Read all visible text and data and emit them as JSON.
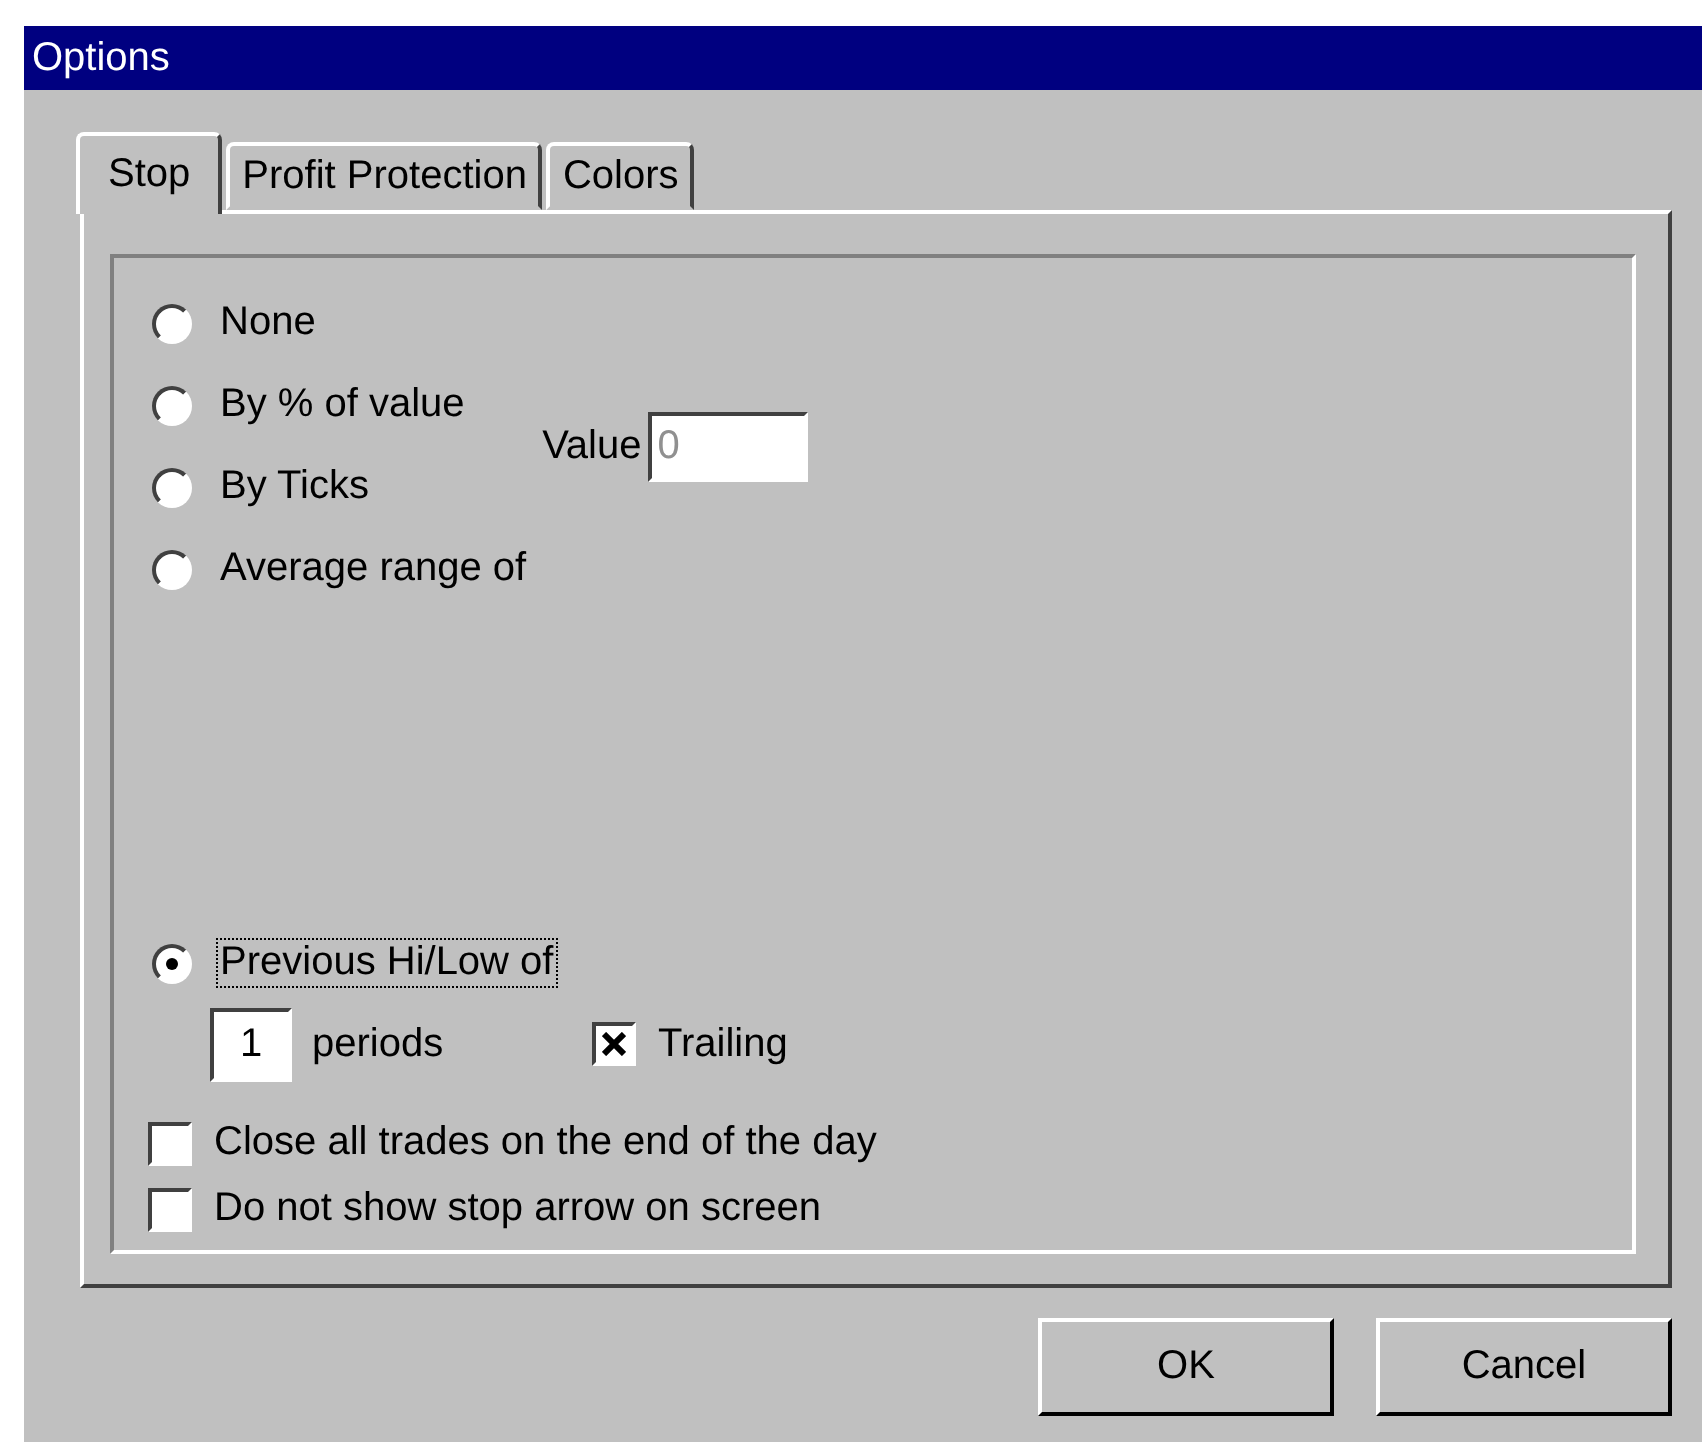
{
  "window": {
    "title": "Options"
  },
  "tabs": [
    {
      "label": "Stop",
      "selected": true
    },
    {
      "label": "Profit Protection",
      "selected": false
    },
    {
      "label": "Colors",
      "selected": false
    }
  ],
  "stop_options": [
    {
      "label": "None",
      "selected": false,
      "focused": false
    },
    {
      "label": "By % of value",
      "selected": false,
      "focused": false
    },
    {
      "label": "By Ticks",
      "selected": false,
      "focused": false
    },
    {
      "label": "Average range of",
      "selected": false,
      "focused": false
    },
    {
      "label": "Previous Hi/Low of",
      "selected": true,
      "focused": true
    }
  ],
  "value_field": {
    "label": "Value",
    "value": "0",
    "disabled": true
  },
  "periods_field": {
    "value": "1",
    "label": "periods"
  },
  "trailing": {
    "label": "Trailing",
    "checked": true
  },
  "checkboxes": [
    {
      "label": "Close all trades on the end of the day",
      "checked": false
    },
    {
      "label": "Do not show stop arrow on screen",
      "checked": false
    }
  ],
  "buttons": [
    {
      "label": "OK"
    },
    {
      "label": "Cancel"
    }
  ]
}
